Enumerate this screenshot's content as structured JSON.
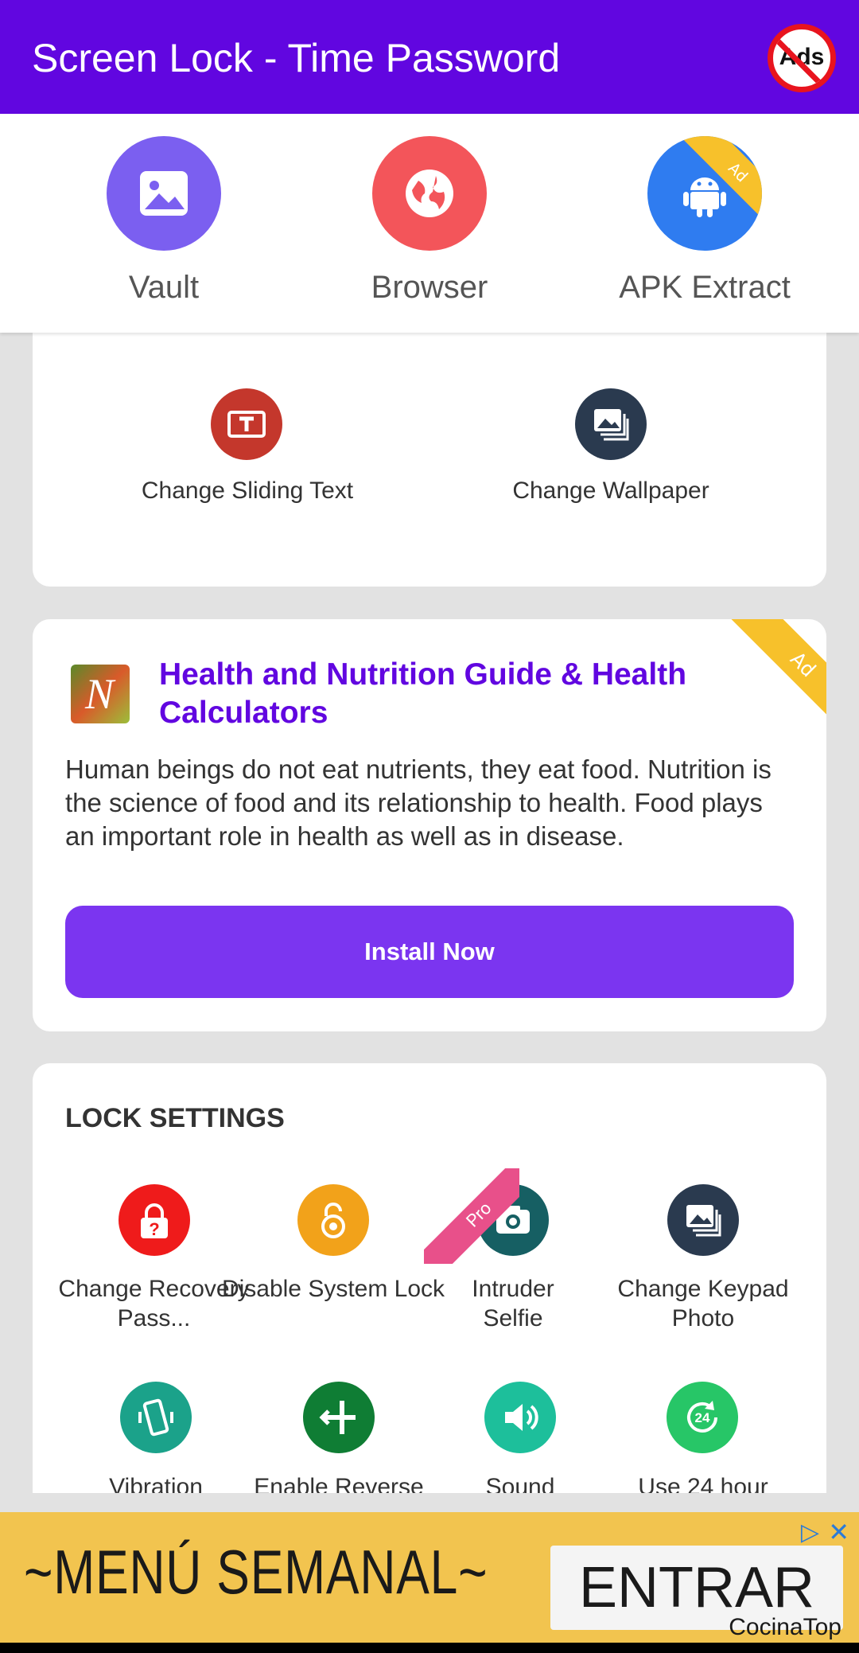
{
  "app_bar": {
    "title": "Screen Lock - Time Password",
    "no_ads_label": "Ads"
  },
  "quick_apps": [
    {
      "label": "Vault",
      "color": "#7b5ff0",
      "icon": "image-icon"
    },
    {
      "label": "Browser",
      "color": "#f3555a",
      "icon": "globe-icon"
    },
    {
      "label": "APK Extract",
      "color": "#2f7cf0",
      "icon": "android-icon",
      "badge": "Ad"
    }
  ],
  "customize_card": {
    "items": [
      {
        "label": "Change Sliding Text",
        "color": "#c4372c",
        "icon": "sliding-text-icon"
      },
      {
        "label": "Change Wallpaper",
        "color": "#2a3a4f",
        "icon": "wallpaper-icon"
      }
    ]
  },
  "ad_card": {
    "badge": "Ad",
    "logo_letter": "N",
    "title": "Health and Nutrition Guide & Health Calculators",
    "description": "Human beings do not eat nutrients, they eat food. Nutrition is the science of food and its relationship to health. Food plays an important role in health as well as in disease.",
    "install_label": "Install Now"
  },
  "lock_settings": {
    "title": "LOCK SETTINGS",
    "items": [
      {
        "label": "Change Recovery Pass...",
        "color": "#ef1b1b",
        "icon": "lock-question-icon"
      },
      {
        "label": "Disable System Lock",
        "color": "#f2a21a",
        "icon": "unlock-icon"
      },
      {
        "label": "Intruder Selfie",
        "color": "#165f63",
        "icon": "camera-icon",
        "badge": "Pro"
      },
      {
        "label": "Change Keypad Photo",
        "color": "#2a3a4f",
        "icon": "keypad-photo-icon"
      },
      {
        "label": "Vibration",
        "color": "#1ba28a",
        "icon": "vibration-icon"
      },
      {
        "label": "Enable Reverse",
        "color": "#0f7d34",
        "icon": "reverse-icon"
      },
      {
        "label": "Sound",
        "color": "#1dbf9b",
        "icon": "sound-icon"
      },
      {
        "label": "Use 24 hour",
        "color": "#27c667",
        "icon": "clock-24-icon"
      }
    ]
  },
  "banner_ad": {
    "headline": "~MENÚ SEMANAL~",
    "cta": "ENTRAR",
    "brand": "CocinaTop",
    "adchoices": "▷",
    "close": "✕"
  }
}
